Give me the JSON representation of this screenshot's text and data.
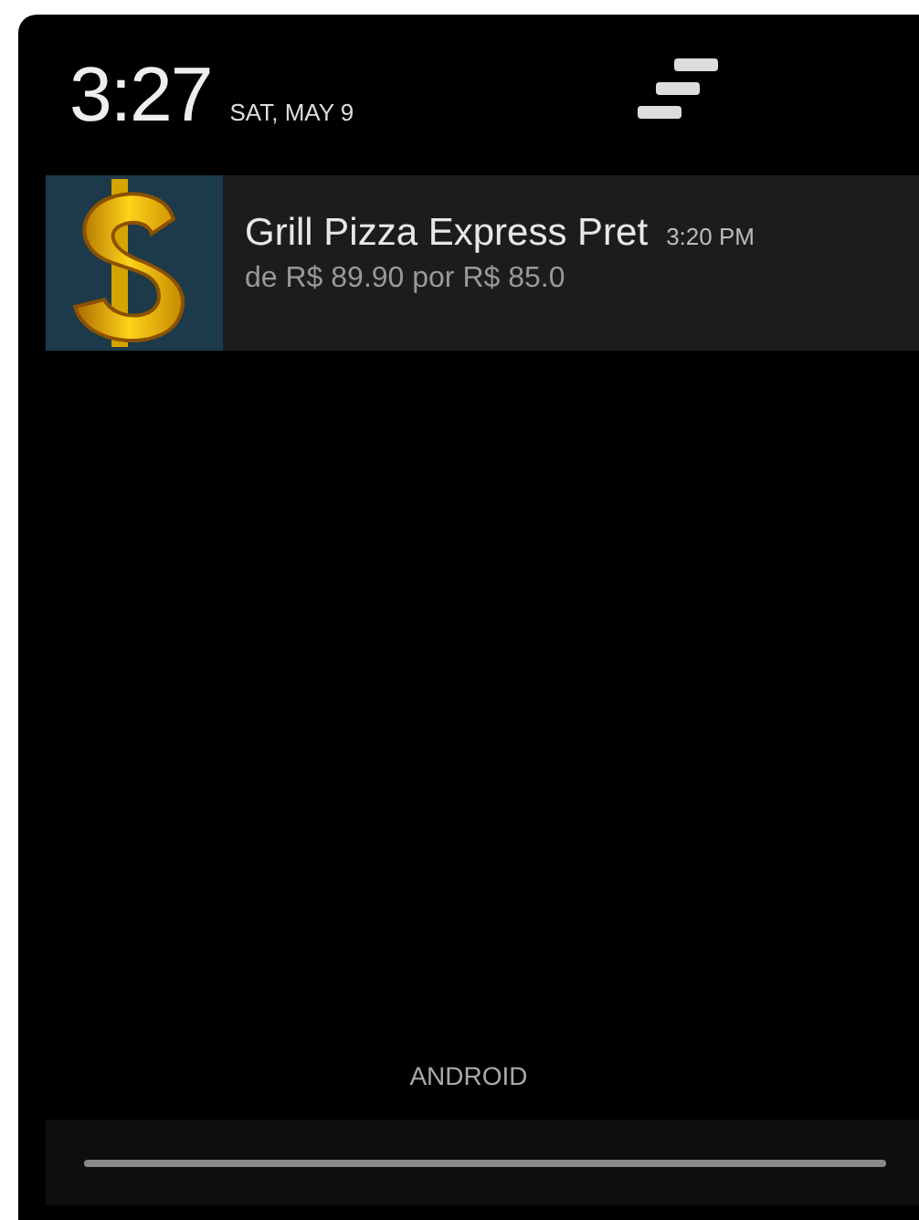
{
  "header": {
    "time": "3:27",
    "date": "SAT, MAY 9"
  },
  "notifications": [
    {
      "title": "Grill Pizza Express Pret",
      "time": "3:20 PM",
      "text": "de R$ 89.90 por R$ 85.0"
    }
  ],
  "footer": {
    "carrier": "ANDROID"
  }
}
